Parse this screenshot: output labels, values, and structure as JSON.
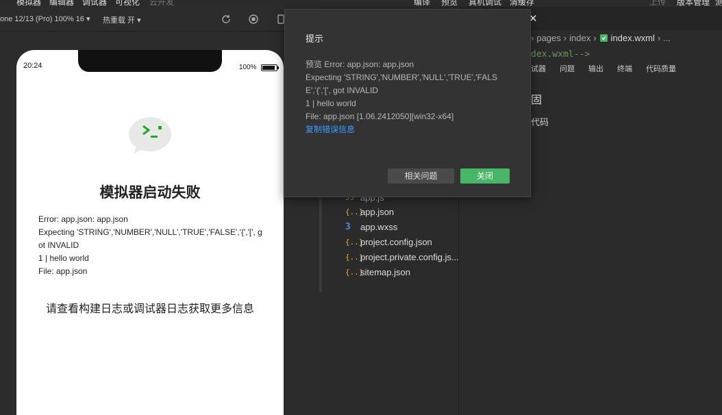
{
  "topmenu": {
    "left": [
      "模拟器",
      "编辑器",
      "调试器",
      "可视化",
      "云开发"
    ],
    "right": [
      "编译",
      "预览",
      "真机调试",
      "清缓存"
    ],
    "far_right": [
      "上传",
      "版本管理",
      "测"
    ]
  },
  "simulator": {
    "device_label": "one 12/13 (Pro) 100% 16 ▾",
    "hot_reload_label": "热重载 开 ▾",
    "phone": {
      "time": "20:24",
      "battery": "100%",
      "title": "模拟器启动失败",
      "error_lines": [
        "Error: app.json: app.json",
        "Expecting 'STRING','NUMBER','NULL','TRUE','FALSE','{','[', got INVALID",
        "1 | hello world",
        "File: app.json"
      ],
      "hint": "请查看构建日志或调试器日志获取更多信息"
    }
  },
  "explorer": {
    "files": [
      {
        "icon": "js-file-icon",
        "glyph": "JS",
        "name": "app.js"
      },
      {
        "icon": "json-file-icon",
        "glyph": "{..}",
        "name": "app.json"
      },
      {
        "icon": "css-file-icon",
        "glyph": "3",
        "name": "app.wxss"
      },
      {
        "icon": "json-file-icon",
        "glyph": "{..}",
        "name": "project.config.json"
      },
      {
        "icon": "json-file-icon",
        "glyph": "{..}",
        "name": "project.private.config.js..."
      },
      {
        "icon": "json-file-icon",
        "glyph": "{..}",
        "name": "sitemap.json"
      }
    ]
  },
  "editor": {
    "breadcrumb": [
      "pages",
      "index",
      "index.wxml",
      "..."
    ],
    "code_line": "dex.wxml-->",
    "panel_tabs": [
      "试器",
      "问题",
      "输出",
      "终端",
      "代码质量"
    ],
    "panel_big": "固",
    "panel_sub": "代码"
  },
  "modal": {
    "title": "提示",
    "lines": [
      "预览 Error: app.json: app.json",
      "Expecting 'STRING','NUMBER','NULL','TRUE','FALSE','{','[', got INVALID",
      "1 | hello world",
      "File: app.json [1.06.2412050][win32-x64]"
    ],
    "copy_label": "复制错误信息",
    "related_label": "相关问题",
    "close_label": "关闭"
  },
  "colors": {
    "accent_green": "#47b766",
    "link_blue": "#3d9bff",
    "code_comment": "#6a9955"
  }
}
